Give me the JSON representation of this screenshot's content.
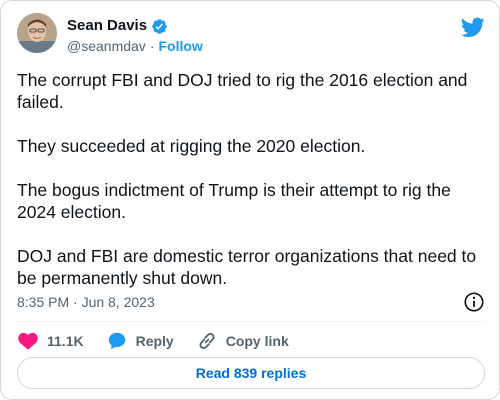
{
  "author": {
    "display_name": "Sean Davis",
    "handle": "@seanmdav",
    "separator": "·",
    "follow_label": "Follow",
    "verified_icon": "verified-badge-icon",
    "verified_color": "#1d9bf0"
  },
  "brand": {
    "logo_icon": "twitter-bird-icon",
    "color": "#1d9bf0"
  },
  "tweet": {
    "paragraphs": [
      "The corrupt FBI and DOJ tried to rig the 2016 election and failed.",
      "They succeeded at rigging the 2020 election.",
      "The bogus indictment of Trump is their attempt to rig the 2024 election.",
      "DOJ and FBI are domestic terror organizations that need to be permanently shut down."
    ],
    "timestamp": "8:35 PM · Jun 8, 2023",
    "info_icon": "info-icon"
  },
  "actions": {
    "like_count": "11.1K",
    "like_color": "#f91880",
    "reply_label": "Reply",
    "reply_color": "#1d9bf0",
    "copy_link_label": "Copy link"
  },
  "replies": {
    "label": "Read 839 replies"
  }
}
